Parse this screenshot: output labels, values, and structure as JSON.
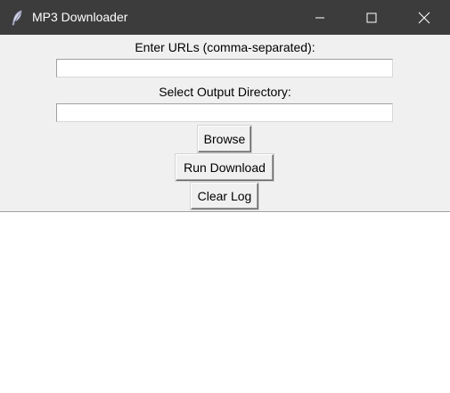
{
  "window": {
    "title": "MP3 Downloader",
    "icon": "feather-icon",
    "controls": [
      "minimize-icon",
      "maximize-icon",
      "close-icon"
    ]
  },
  "form": {
    "urls_label": "Enter URLs (comma-separated):",
    "urls_value": "",
    "output_dir_label": "Select Output Directory:",
    "output_dir_value": ""
  },
  "buttons": {
    "browse": "Browse",
    "run": "Run Download",
    "clear_log": "Clear Log"
  },
  "log": {
    "text": ""
  },
  "colors": {
    "titlebar": "#3c3c3c",
    "window_bg": "#f0f0f0",
    "log_bg": "#ffffff"
  }
}
